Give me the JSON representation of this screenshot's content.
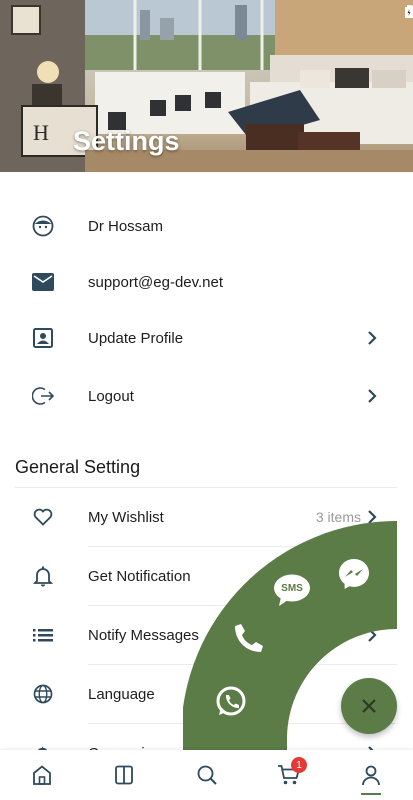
{
  "header": {
    "title": "Settings"
  },
  "colors": {
    "accent": "#5b7b47",
    "icon": "#2e4a5c",
    "badge": "#e53935"
  },
  "account": [
    {
      "icon": "face-icon",
      "label": "Dr Hossam"
    },
    {
      "icon": "mail-icon",
      "label": "support@eg-dev.net"
    },
    {
      "icon": "profile-icon",
      "label": "Update Profile"
    },
    {
      "icon": "logout-icon",
      "label": "Logout"
    }
  ],
  "general": {
    "title": "General Setting",
    "items": [
      {
        "icon": "heart-icon",
        "label": "My Wishlist",
        "meta": "3 items"
      },
      {
        "icon": "bell-icon",
        "label": "Get Notification"
      },
      {
        "icon": "list-icon",
        "label": "Notify Messages"
      },
      {
        "icon": "globe-icon",
        "label": "Language"
      },
      {
        "icon": "dollar-icon",
        "label": "Currencies"
      }
    ]
  },
  "fab": {
    "items": [
      {
        "icon": "messenger-icon"
      },
      {
        "icon": "sms-icon",
        "label": "SMS"
      },
      {
        "icon": "phone-icon"
      },
      {
        "icon": "whatsapp-icon"
      }
    ],
    "toggle_icon": "close-icon"
  },
  "bottom_nav": {
    "items": [
      {
        "icon": "home-icon"
      },
      {
        "icon": "book-icon"
      },
      {
        "icon": "search-icon"
      },
      {
        "icon": "cart-icon",
        "badge": "1"
      },
      {
        "icon": "person-icon",
        "active": true
      }
    ]
  }
}
